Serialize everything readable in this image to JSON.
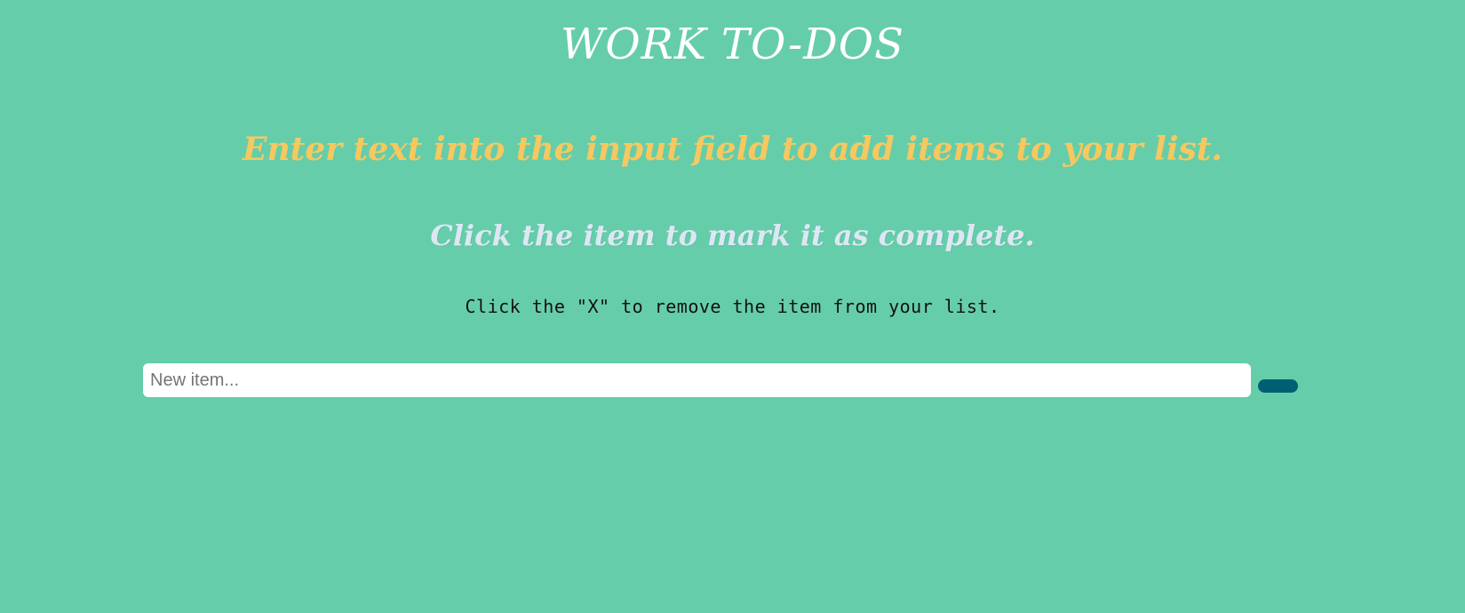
{
  "header": {
    "title": "WORK TO-DOS"
  },
  "instructions": {
    "add": "Enter text into the input field to add items to your list.",
    "complete": "Click the item to mark it as complete.",
    "remove": "Click the \"X\" to remove the item from your list."
  },
  "form": {
    "input_value": "",
    "input_placeholder": "New item...",
    "add_button_label": ""
  },
  "colors": {
    "background": "#66cdaa",
    "title": "#ffffff",
    "instruction_add": "#f7c85f",
    "instruction_complete": "#dde7f4",
    "instruction_remove": "#111111",
    "add_button": "#005f73"
  },
  "list": {
    "items": []
  }
}
